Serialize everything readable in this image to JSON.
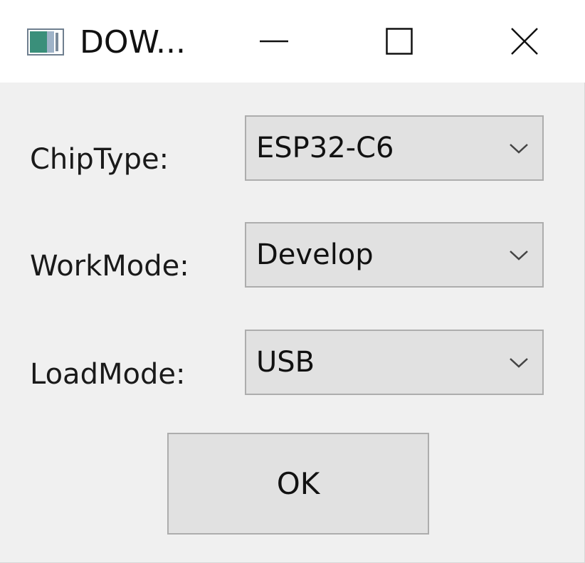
{
  "window": {
    "title": "DOW..."
  },
  "caption_buttons": {
    "minimize_icon": "minimize-icon",
    "maximize_icon": "maximize-icon",
    "close_icon": "close-icon"
  },
  "form": {
    "chip_type": {
      "label": "ChipType:",
      "value": "ESP32-C6"
    },
    "work_mode": {
      "label": "WorkMode:",
      "value": "Develop"
    },
    "load_mode": {
      "label": "LoadMode:",
      "value": "USB"
    },
    "ok_label": "OK"
  },
  "colors": {
    "titlebar_bg": "#ffffff",
    "client_bg": "#f0f0f0",
    "control_bg": "#e1e1e1",
    "control_border": "#adadad"
  }
}
